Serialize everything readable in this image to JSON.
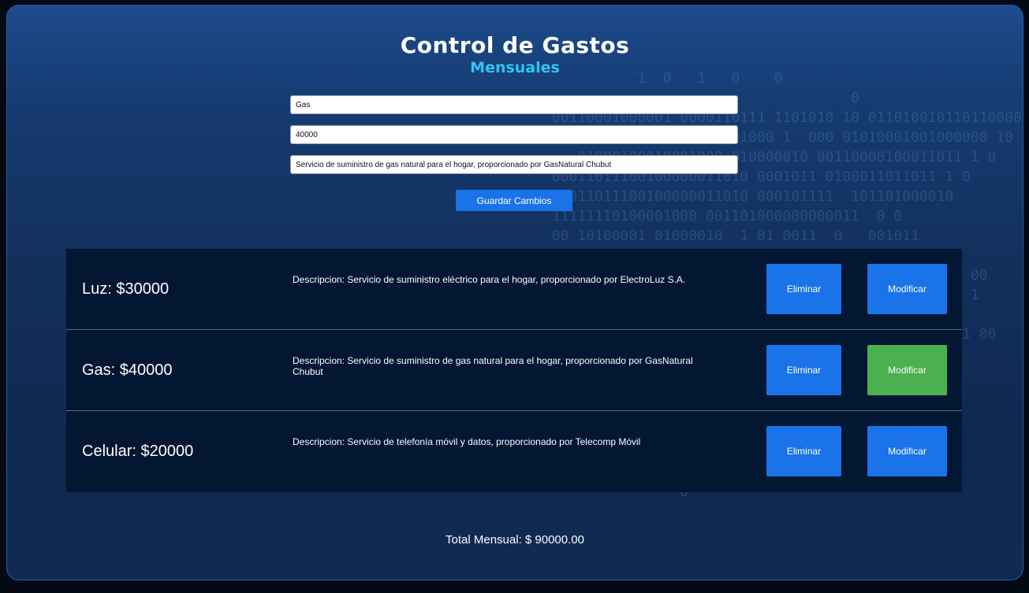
{
  "header": {
    "title": "Control de Gastos",
    "subtitle": "Mensuales"
  },
  "form": {
    "name_value": "Gas",
    "amount_value": "40000",
    "description_value": "Servicio de suministro de gas natural para el hogar, proporcionado por GasNatural Chubut",
    "save_label": "Guardar Cambios"
  },
  "expenses": [
    {
      "name": "Luz: $30000",
      "description": "Descripcion: Servicio de suministro eléctrico para el hogar, proporcionado por ElectroLuz S.A.",
      "delete_label": "Eliminar",
      "edit_label": "Modificar",
      "editing": false
    },
    {
      "name": "Gas: $40000",
      "description": "Descripcion: Servicio de suministro de gas natural para el hogar, proporcionado por GasNatural Chubut",
      "delete_label": "Eliminar",
      "edit_label": "Modificar",
      "editing": true
    },
    {
      "name": "Celular: $20000",
      "description": "Descripcion: Servicio de telefonía móvil y datos, proporcionado por Telecomp Móvil",
      "delete_label": "Eliminar",
      "edit_label": "Modificar",
      "editing": false
    }
  ],
  "total": "Total Mensual: $ 90000.00",
  "colors": {
    "accent_blue": "#1a73e8",
    "active_green": "#4caf50",
    "subtitle_cyan": "#2fc4f5",
    "list_background": "#031632"
  }
}
